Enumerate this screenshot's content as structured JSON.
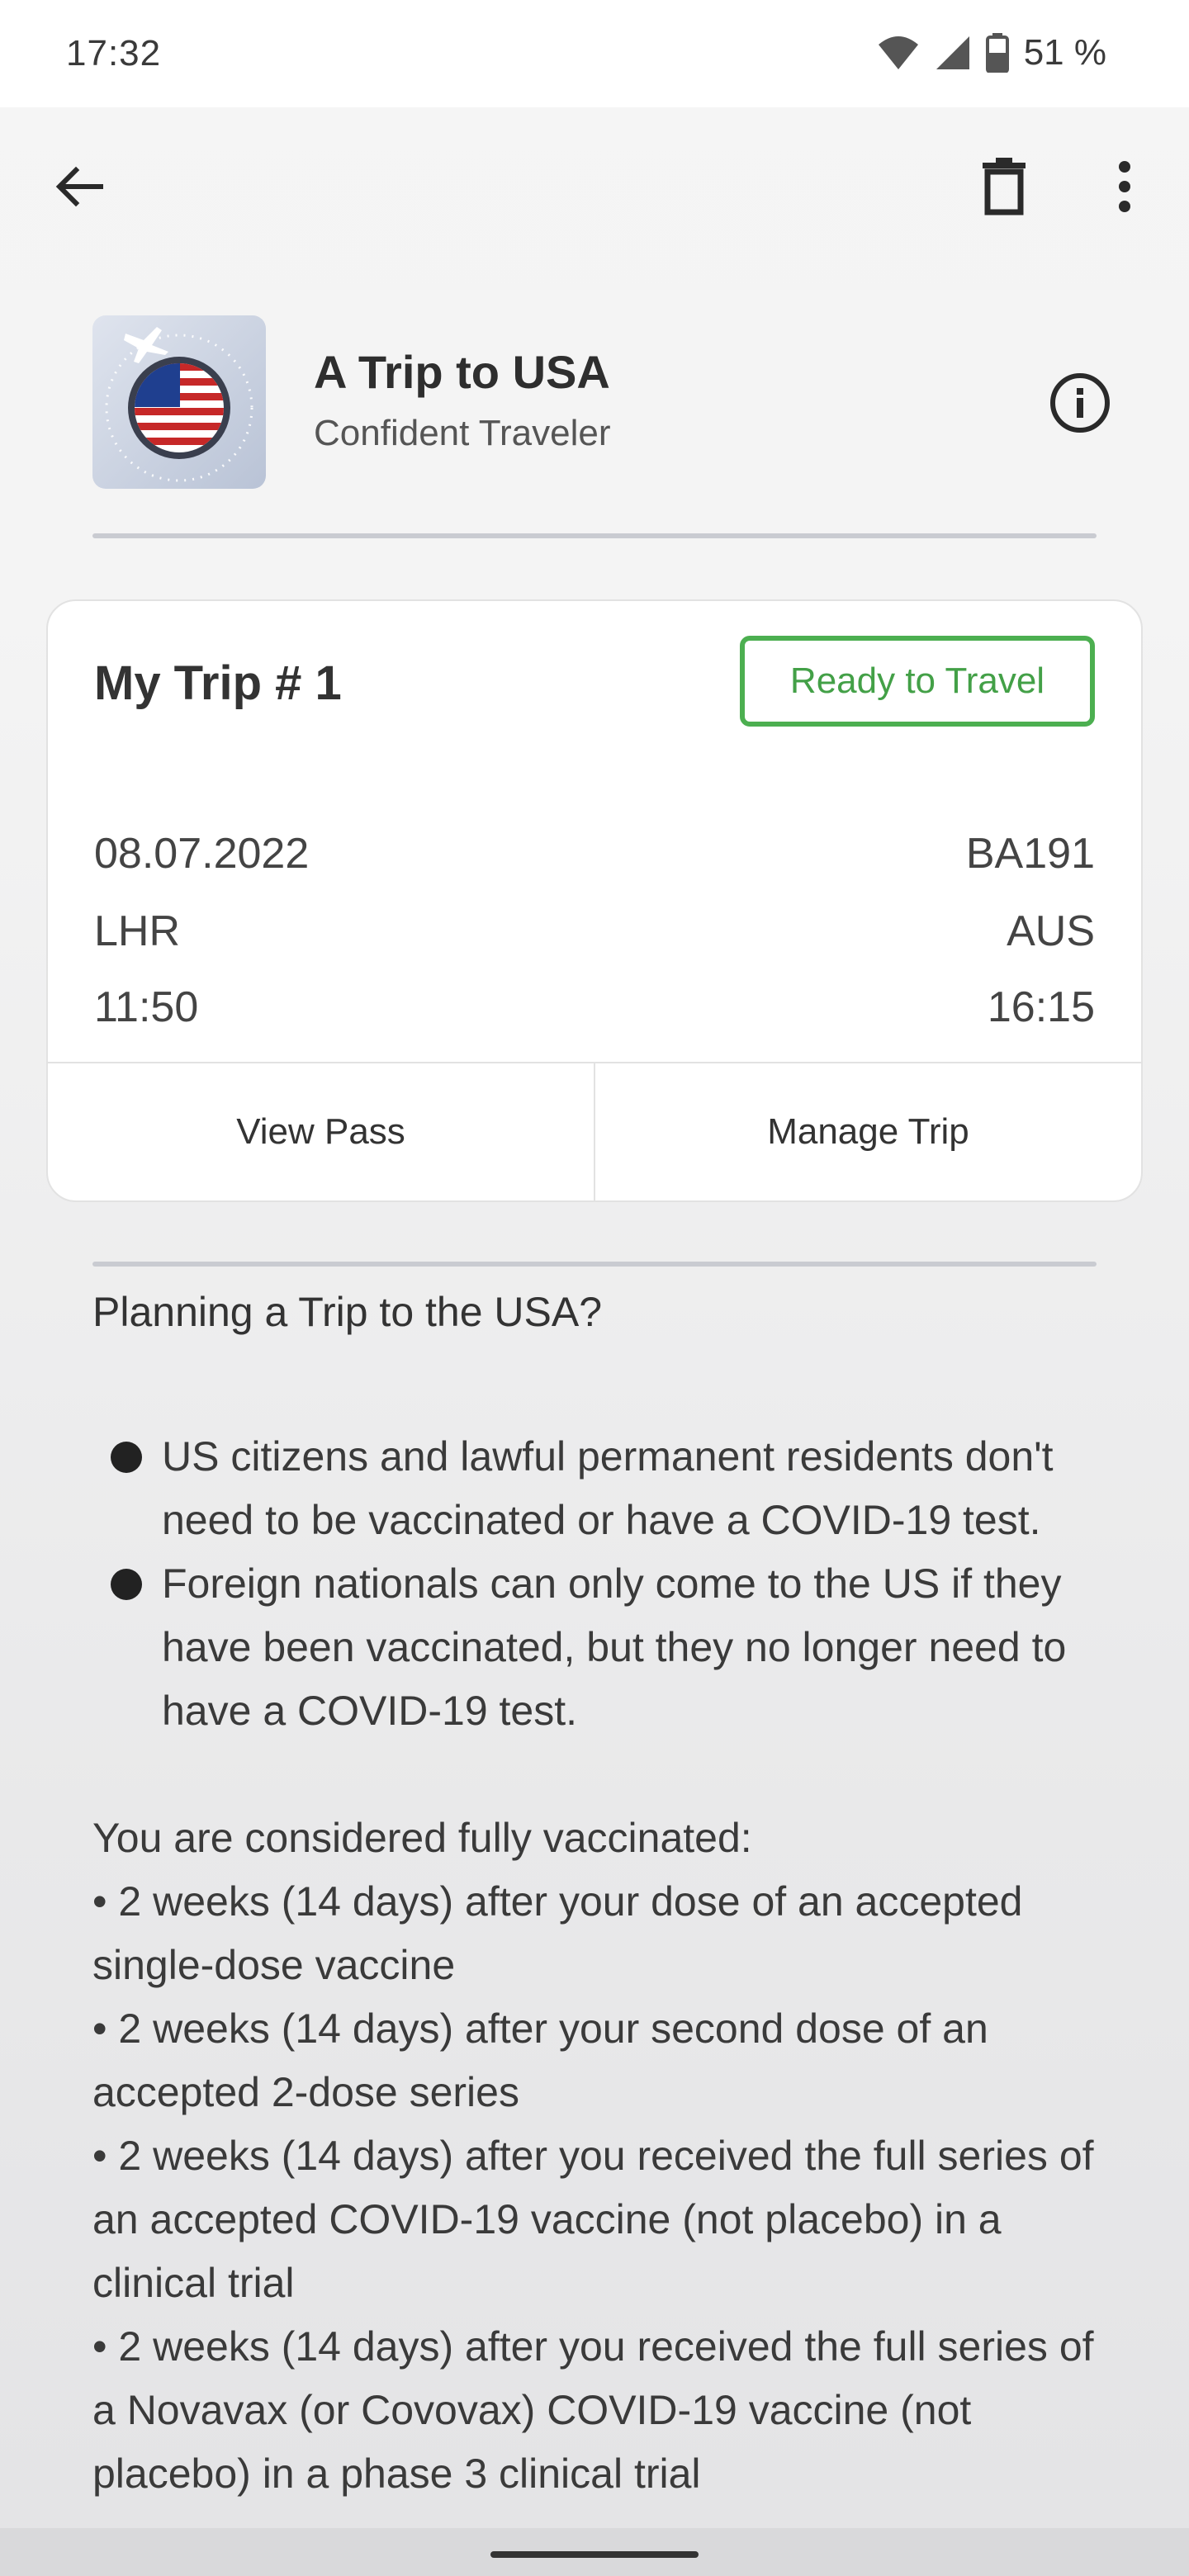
{
  "status_bar": {
    "time": "17:32",
    "battery": "51 %",
    "icons": [
      "wifi-icon",
      "signal-icon",
      "battery-icon"
    ]
  },
  "app_bar": {
    "icons": [
      "back-arrow-icon",
      "trash-icon",
      "more-vert-icon"
    ]
  },
  "header": {
    "title": "A Trip to USA",
    "subtitle": "Confident Traveler",
    "image": "us-flag-badge",
    "info_icon": "info-icon"
  },
  "trip_card": {
    "name": "My Trip # 1",
    "status_badge": "Ready to Travel",
    "date": "08.07.2022",
    "flight": "BA191",
    "origin": "LHR",
    "destination": "AUS",
    "departure_time": "11:50",
    "arrival_time": "16:15",
    "actions": {
      "view_pass": "View Pass",
      "manage_trip": "Manage Trip"
    }
  },
  "info": {
    "title": "Planning a Trip to the USA?",
    "bullets": [
      "US citizens and lawful permanent residents don't need to be vaccinated or have a COVID-19 test.",
      "Foreign nationals can only come to the US if they have been vaccinated, but they no longer need to have a COVID-19 test."
    ],
    "vaccinated_title": "You are considered fully vaccinated:",
    "vaccinated_items": [
      "• 2 weeks (14 days) after your dose of an accepted single-dose vaccine",
      "• 2 weeks (14 days) after your second dose of an accepted 2-dose series",
      "• 2 weeks (14 days) after you received the full series of an accepted COVID-19 vaccine (not placebo) in a clinical trial",
      "• 2 weeks (14 days) after you received the full series of a Novavax (or Covovax) COVID-19 vaccine (not placebo) in a phase 3 clinical trial"
    ]
  },
  "colors": {
    "accent_green": "#4caf50",
    "card_bg": "#ffffff",
    "divider": "#c9cbd1"
  }
}
